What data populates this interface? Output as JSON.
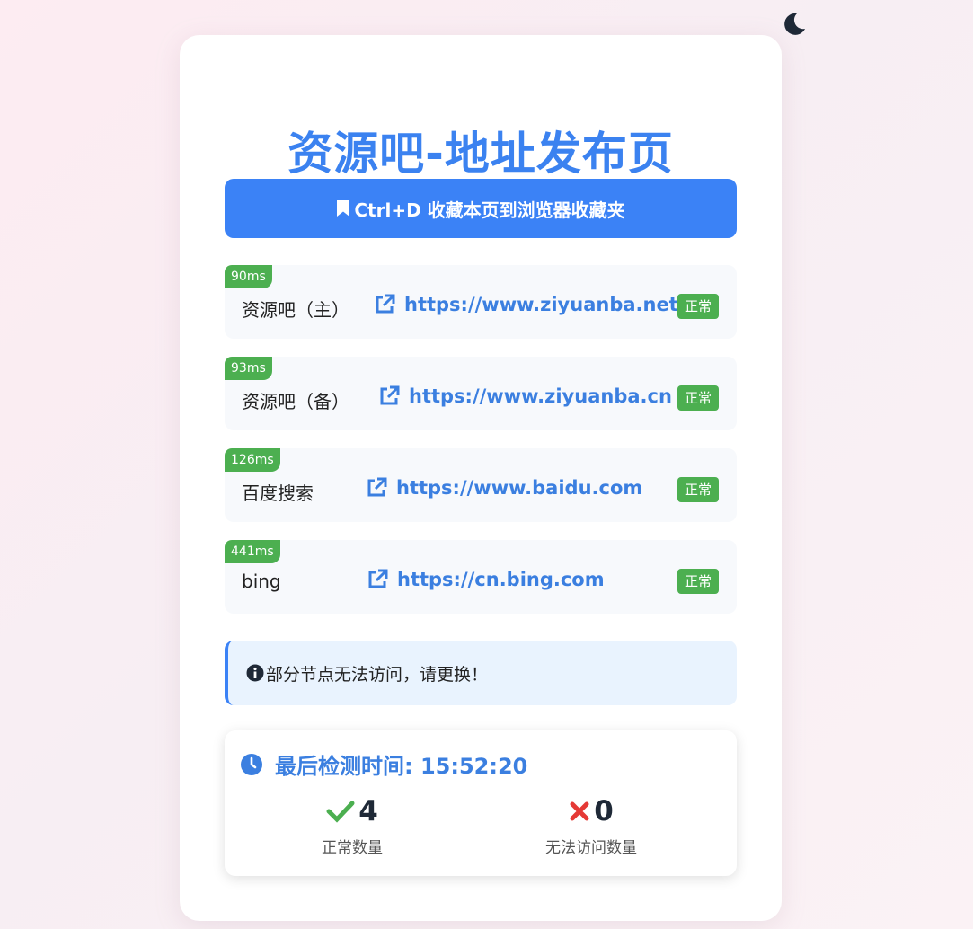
{
  "theme_toggle": {
    "icon": "moon-icon"
  },
  "page": {
    "title": "资源吧-地址发布页",
    "bookmark_label": "Ctrl+D 收藏本页到浏览器收藏夹"
  },
  "links": [
    {
      "latency": "90ms",
      "name": "资源吧（主）",
      "url": "https://www.ziyuanba.net",
      "status": "正常"
    },
    {
      "latency": "93ms",
      "name": "资源吧（备）",
      "url": "https://www.ziyuanba.cn",
      "status": "正常"
    },
    {
      "latency": "126ms",
      "name": "百度搜索",
      "url": "https://www.baidu.com",
      "status": "正常"
    },
    {
      "latency": "441ms",
      "name": "bing",
      "url": "https://cn.bing.com",
      "status": "正常"
    }
  ],
  "notice": {
    "text": "部分节点无法访问，请更换！"
  },
  "stats": {
    "last_check_label": "最后检测时间: 15:52:20",
    "ok_count": "4",
    "ok_label": "正常数量",
    "fail_count": "0",
    "fail_label": "无法访问数量"
  },
  "colors": {
    "accent": "#3b82f6",
    "success": "#4caf50",
    "error": "#e53935"
  }
}
